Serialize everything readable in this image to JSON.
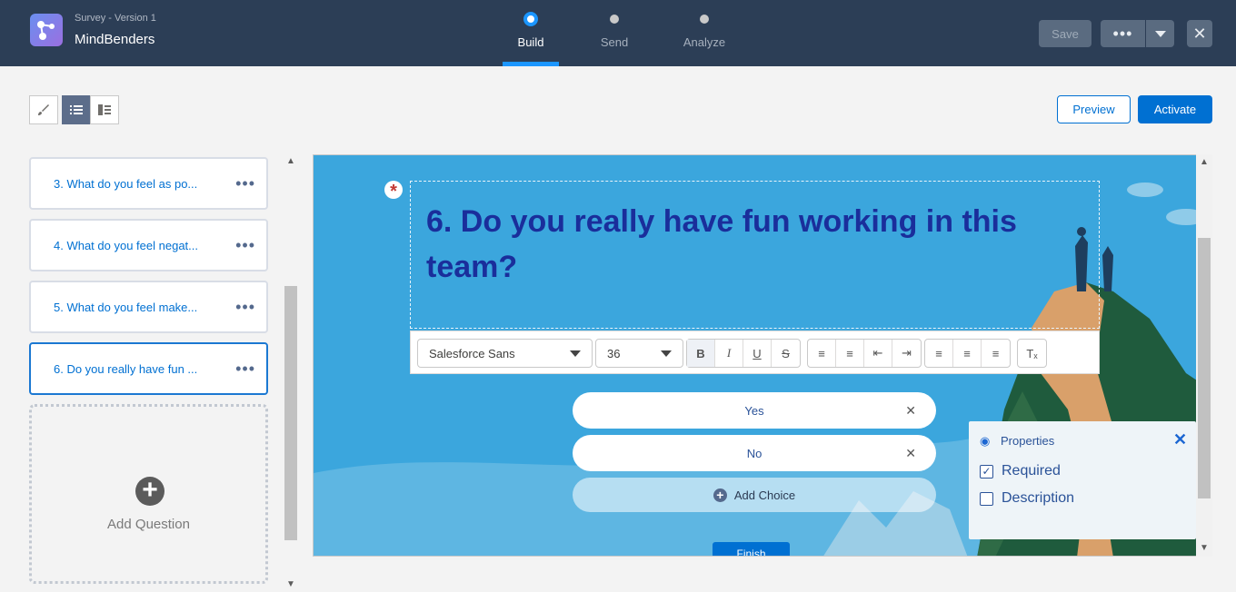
{
  "header": {
    "subtitle": "Survey - Version 1",
    "title": "MindBenders",
    "steps": [
      {
        "label": "Build",
        "active": true
      },
      {
        "label": "Send",
        "active": false
      },
      {
        "label": "Analyze",
        "active": false
      }
    ],
    "save_label": "Save",
    "more_label": "•••",
    "close_label": "✕"
  },
  "toolbar": {
    "preview_label": "Preview",
    "activate_label": "Activate"
  },
  "questions": [
    {
      "label": "3. What do you feel as po..."
    },
    {
      "label": "4. What do you feel negat..."
    },
    {
      "label": "5. What do you feel make..."
    },
    {
      "label": "6. Do you really have fun ..."
    }
  ],
  "question_more": "•••",
  "add_question_label": "Add Question",
  "editor": {
    "question_title": "6. Do you really have fun working in this team?",
    "required_marker": "*",
    "font_family_value": "Salesforce Sans",
    "font_size_value": "36",
    "choices": [
      {
        "label": "Yes"
      },
      {
        "label": "No"
      }
    ],
    "add_choice_label": "Add Choice",
    "finish_label": "Finish"
  },
  "properties": {
    "title": "Properties",
    "required_label": "Required",
    "required_checked": true,
    "description_label": "Description",
    "description_checked": false
  },
  "colors": {
    "brand": "#0070d2",
    "header_bg": "#2c3e56",
    "canvas_bg": "#3ba6dd",
    "question_text": "#1a2e9b"
  }
}
